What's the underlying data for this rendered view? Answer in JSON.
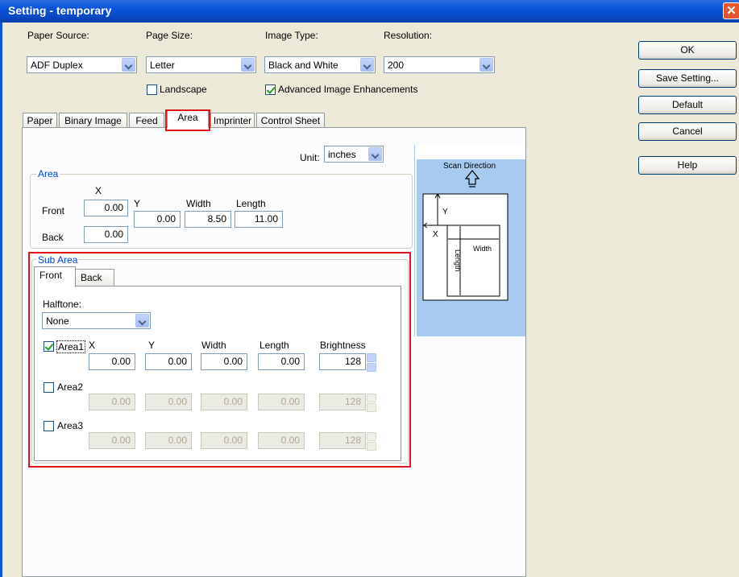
{
  "window": {
    "title": "Setting - temporary",
    "close_glyph": "✕"
  },
  "top": {
    "paper_source": {
      "label": "Paper Source:",
      "value": "ADF Duplex"
    },
    "page_size": {
      "label": "Page Size:",
      "value": "Letter"
    },
    "image_type": {
      "label": "Image Type:",
      "value": "Black and White"
    },
    "resolution": {
      "label": "Resolution:",
      "value": "200"
    },
    "landscape": {
      "label": "Landscape",
      "checked": false
    },
    "enhancements": {
      "label": "Advanced Image Enhancements",
      "checked": true
    }
  },
  "buttons": {
    "ok": "OK",
    "save": "Save Setting...",
    "default": "Default",
    "cancel": "Cancel",
    "help": "Help"
  },
  "tabs": [
    "Paper",
    "Binary Image",
    "Feed",
    "Area",
    "Imprinter",
    "Control Sheet"
  ],
  "selected_tab": "Area",
  "unit": {
    "label": "Unit:",
    "value": "inches"
  },
  "area": {
    "title": "Area",
    "x_label": "X",
    "y_label": "Y",
    "width_label": "Width",
    "length_label": "Length",
    "front_label": "Front",
    "back_label": "Back",
    "front_x": "0.00",
    "y": "0.00",
    "width": "8.50",
    "length": "11.00",
    "back_x": "0.00"
  },
  "sub_area": {
    "title": "Sub Area",
    "tabs": [
      "Front",
      "Back"
    ],
    "halftone_label": "Halftone:",
    "halftone_value": "None",
    "col_labels": {
      "x": "X",
      "y": "Y",
      "width": "Width",
      "length": "Length",
      "brightness": "Brightness"
    },
    "rows": [
      {
        "label": "Area1",
        "checked": true,
        "x": "0.00",
        "y": "0.00",
        "width": "0.00",
        "length": "0.00",
        "brightness": "128"
      },
      {
        "label": "Area2",
        "checked": false,
        "x": "0.00",
        "y": "0.00",
        "width": "0.00",
        "length": "0.00",
        "brightness": "128"
      },
      {
        "label": "Area3",
        "checked": false,
        "x": "0.00",
        "y": "0.00",
        "width": "0.00",
        "length": "0.00",
        "brightness": "128"
      }
    ]
  },
  "diagram": {
    "scan_direction": "Scan Direction",
    "y": "Y",
    "x": "X",
    "width": "Width",
    "length": "Length"
  },
  "colors": {
    "title_bar": "#0a55d8",
    "highlight": "#e0141a",
    "group_title": "#0046d5",
    "preview_bg": "#a6caf0"
  }
}
